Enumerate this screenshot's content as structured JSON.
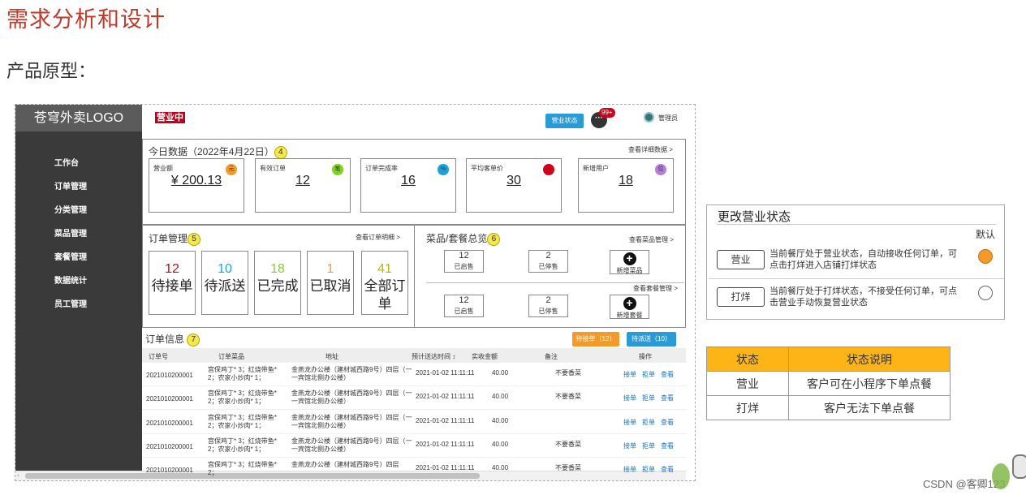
{
  "heading": "需求分析和设计",
  "subheading": "产品原型：",
  "mock": {
    "logo": "苍穹外卖LOGO",
    "status_tag": "营业中",
    "status_button": "营业状态",
    "chat_icon": "···",
    "message_badge": "99+",
    "admin": "管理员",
    "nav": [
      "工作台",
      "订单管理",
      "分类管理",
      "菜品管理",
      "套餐管理",
      "数据统计",
      "员工管理"
    ],
    "today": {
      "title": "今日数据（2022年4月22日）",
      "index": "4",
      "link": "查看详细数据",
      "cards": [
        {
          "label": "营业额",
          "value": "¥ 200.13",
          "icon": "元",
          "color": "#f39a2b"
        },
        {
          "label": "有效订单",
          "value": "12",
          "icon": "笔",
          "color": "#7ed321"
        },
        {
          "label": "订单完成率",
          "value": "16",
          "icon": "%",
          "color": "#1aa3d9"
        },
        {
          "label": "平均客单价",
          "value": "30",
          "icon": "",
          "color": "#d0021b"
        },
        {
          "label": "新增用户",
          "value": "18",
          "icon": "位",
          "color": "#b57be0"
        }
      ]
    },
    "orders": {
      "title": "订单管理",
      "index": "5",
      "link": "查看订单明细",
      "boxes": [
        {
          "num": "12",
          "label": "待接单",
          "color": "#d0021b"
        },
        {
          "num": "10",
          "label": "待派送",
          "color": "#1aa3d9"
        },
        {
          "num": "18",
          "label": "已完成",
          "color": "#7ed321"
        },
        {
          "num": "1",
          "label": "已取消",
          "color": "#f39a2b"
        },
        {
          "num": "41",
          "label": "全部订单",
          "color": "#b8b800"
        }
      ]
    },
    "dishes": {
      "title": "菜品/套餐总览",
      "index": "6",
      "link1": "查看菜品管理",
      "link2": "查看套餐管理",
      "row1": [
        {
          "num": "12",
          "label": "已启售"
        },
        {
          "num": "2",
          "label": "已停售"
        },
        {
          "add": "新增菜品"
        }
      ],
      "row2": [
        {
          "num": "12",
          "label": "已启售"
        },
        {
          "num": "2",
          "label": "已停售"
        },
        {
          "add": "新增套餐"
        }
      ],
      "plus": "+"
    },
    "orderinfo": {
      "title": "订单信息",
      "index": "7",
      "btn1": "待接单（12）",
      "btn2": "待派送（10）",
      "headers": [
        "订单号",
        "订单菜品",
        "地址",
        "预计送达时间 ↕",
        "实收金额",
        "备注",
        "操作"
      ],
      "rows": [
        {
          "no": "2021010200001",
          "dish": "宫保鸡丁* 3；红烧带鱼* 2；农家小炒肉* 1；",
          "addr": "金燕龙办公楼（建材城西路9号）四层（一一宾馆北侧办公楼）",
          "time": "2021-01-02 11:11:11",
          "amt": "40.00",
          "note": "不要香菜",
          "ops": [
            "接单",
            "拒单",
            "查看"
          ]
        },
        {
          "no": "2021010200001",
          "dish": "宫保鸡丁* 3；红烧带鱼* 2；农家小炒肉* 1；",
          "addr": "金燕龙办公楼（建材城西路9号）四层（一一宾馆北侧办公楼）",
          "time": "2021-01-02 11:11:11",
          "amt": "40.00",
          "note": "不要香菜",
          "ops": [
            "接单",
            "拒单",
            "查看"
          ]
        },
        {
          "no": "2021010200001",
          "dish": "宫保鸡丁* 3；红烧带鱼* 2；农家小炒肉* 1；",
          "addr": "金燕龙办公楼（建材城西路9号）四层（一一宾馆北侧办公楼）",
          "time": "2021-01-02 11:11:11",
          "amt": "40.00",
          "note": "",
          "ops": [
            "接单",
            "拒单",
            "查看"
          ]
        },
        {
          "no": "2021010200001",
          "dish": "宫保鸡丁* 3；红烧带鱼* 2；农家小炒肉* 1；",
          "addr": "金燕龙办公楼（建材城西路9号）四层（一一宾馆北侧办公楼）",
          "time": "2021-01-02 11:11:11",
          "amt": "40.00",
          "note": "不要香菜",
          "ops": [
            "接单",
            "拒单",
            "查看"
          ]
        },
        {
          "no": "2021010200001",
          "dish": "宫保鸡丁* 3；红烧带鱼* 2；",
          "addr": "金燕龙办公楼（建材城西路9号）四层",
          "time": "2021-01-02 11:11:11",
          "amt": "40.00",
          "note": "不要香菜",
          "ops": [
            "接单",
            "拒单",
            "查看"
          ]
        }
      ]
    }
  },
  "change_status": {
    "title": "更改营业状态",
    "default_label": "默认",
    "options": [
      {
        "button": "营业",
        "desc": "当前餐厅处于营业状态，自动接收任何订单，可点击打烊进入店铺打烊状态",
        "selected": true
      },
      {
        "button": "打烊",
        "desc": "当前餐厅处于打烊状态，不接受任何订单，可点击营业手动恢复营业状态",
        "selected": false
      }
    ]
  },
  "status_table": {
    "headers": [
      "状态",
      "状态说明"
    ],
    "rows": [
      [
        "营业",
        "客户可在小程序下单点餐"
      ],
      [
        "打烊",
        "客户无法下单点餐"
      ]
    ]
  },
  "footer": "CSDN @客卿123",
  "colors": {
    "heading": "#c0392b",
    "orange": "#f39a2b",
    "blue": "#2b9bd8",
    "table_header": "#fdb416"
  }
}
